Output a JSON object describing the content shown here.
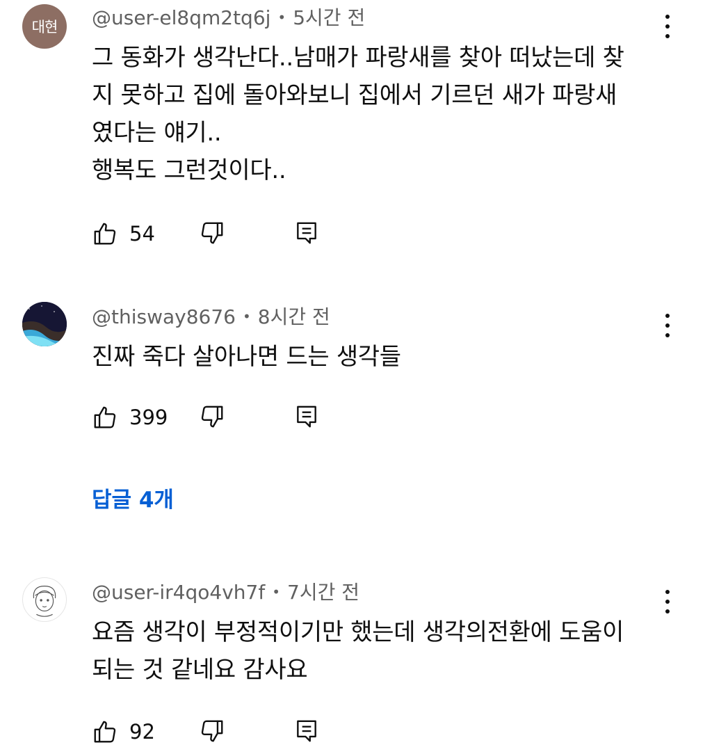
{
  "comments": [
    {
      "avatar_text": "대현",
      "avatar_color": "#8d6e63",
      "handle": "@user-el8qm2tq6j",
      "separator": "•",
      "time": "5시간 전",
      "text": "그 동화가 생각난다..남매가 파랑새를 찾아 떠났는데 찾\n지 못하고 집에 돌아와보니 집에서 기르던 새가 파랑새\n였다는 얘기..\n행복도 그런것이다..",
      "likes": "54"
    },
    {
      "avatar_text": "",
      "avatar_color": "#1a1a3a",
      "handle": "@thisway8676",
      "separator": "•",
      "time": "8시간 전",
      "text": "진짜 죽다 살아나면 드는 생각들",
      "likes": "399",
      "replies_label": "답글 4개"
    },
    {
      "avatar_text": "",
      "avatar_color": "#ffffff",
      "handle": "@user-ir4qo4vh7f",
      "separator": "•",
      "time": "7시간 전",
      "text": "요즘 생각이 부정적이기만 했는데 생각의전환에 도움이\n되는 것 같네요 감사요",
      "likes": "92"
    }
  ],
  "colors": {
    "accent": "#065fd4",
    "meta_text": "#606060",
    "body_text": "#0f0f0f"
  },
  "icons": [
    "thumbs-up-icon",
    "thumbs-down-icon",
    "reply-icon",
    "more-vert-icon"
  ]
}
